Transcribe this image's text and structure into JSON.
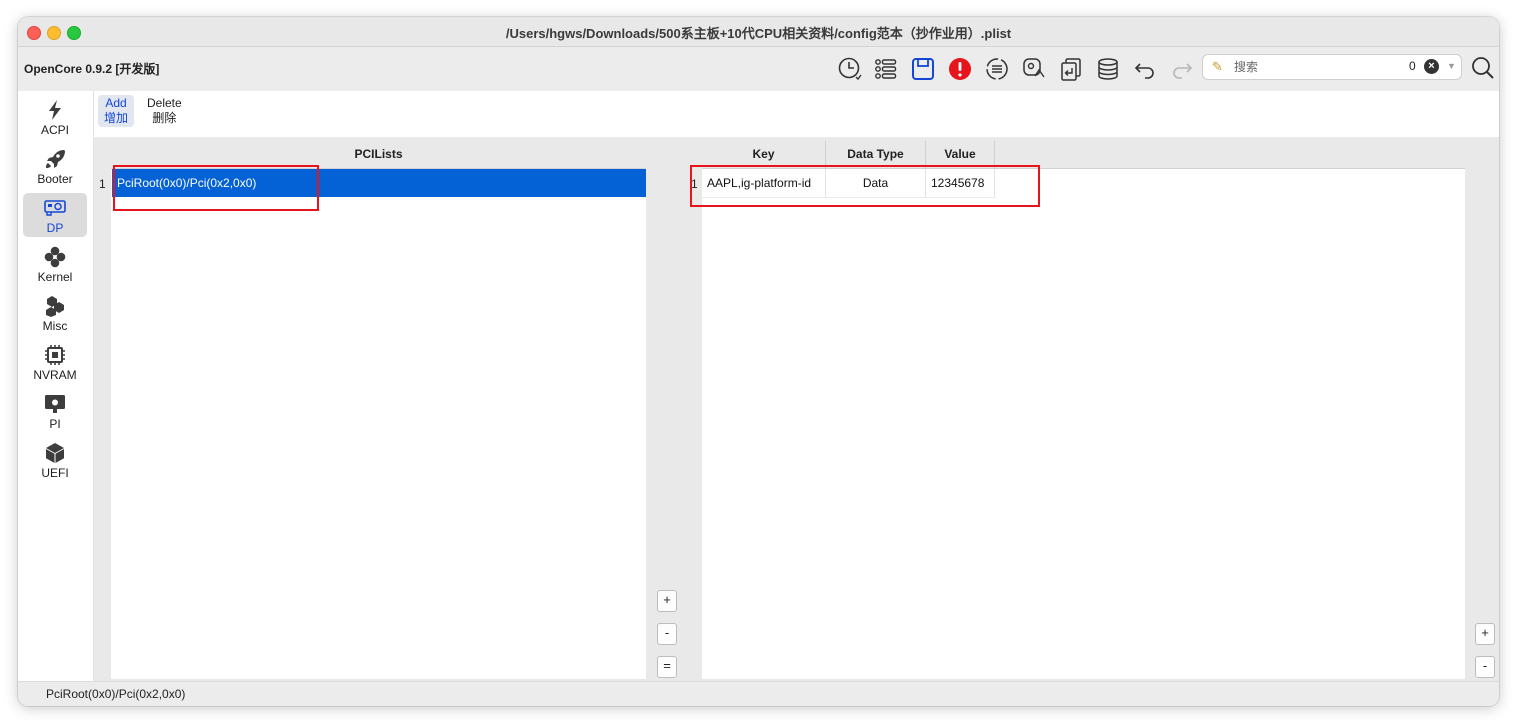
{
  "window": {
    "title": "/Users/hgws/Downloads/500系主板+10代CPU相关资料/config范本（抄作业用）.plist"
  },
  "toolbar": {
    "app_title": "OpenCore 0.9.2 [开发版]",
    "icons": [
      "clock-icon",
      "list-icon",
      "save-icon",
      "error-icon",
      "compare-icon",
      "generate-icon",
      "import-icon",
      "database-icon",
      "undo-icon",
      "redo-icon"
    ],
    "search": {
      "placeholder": "搜索",
      "value": "",
      "count": "0"
    }
  },
  "sidebar": {
    "items": [
      {
        "label": "ACPI",
        "icon": "bolt-icon"
      },
      {
        "label": "Booter",
        "icon": "rocket-icon"
      },
      {
        "label": "DP",
        "icon": "gpu-card-icon",
        "active": true
      },
      {
        "label": "Kernel",
        "icon": "kernel-icon"
      },
      {
        "label": "Misc",
        "icon": "hexagons-icon"
      },
      {
        "label": "NVRAM",
        "icon": "chip-icon"
      },
      {
        "label": "PI",
        "icon": "monitor-apple-icon"
      },
      {
        "label": "UEFI",
        "icon": "cube-icon"
      }
    ]
  },
  "tabs": [
    {
      "en": "Add",
      "zh": "增加",
      "active": true
    },
    {
      "en": "Delete",
      "zh": "删除",
      "active": false
    }
  ],
  "pci_table": {
    "header": "PCILists",
    "rows": [
      {
        "index": "1",
        "value": "PciRoot(0x0)/Pci(0x2,0x0)"
      }
    ]
  },
  "props_table": {
    "headers": {
      "key": "Key",
      "type": "Data Type",
      "value": "Value"
    },
    "rows": [
      {
        "index": "1",
        "key": "AAPL,ig-platform-id",
        "type": "Data",
        "value": "12345678"
      }
    ]
  },
  "buttons": {
    "plus": "+",
    "minus": "-",
    "equal": "="
  },
  "status": {
    "text": "PciRoot(0x0)/Pci(0x2,0x0)"
  },
  "colors": {
    "selection": "#0462d6",
    "highlight_box": "#e8141b",
    "error_icon": "#e8141b",
    "accent_blue": "#1446d6"
  }
}
